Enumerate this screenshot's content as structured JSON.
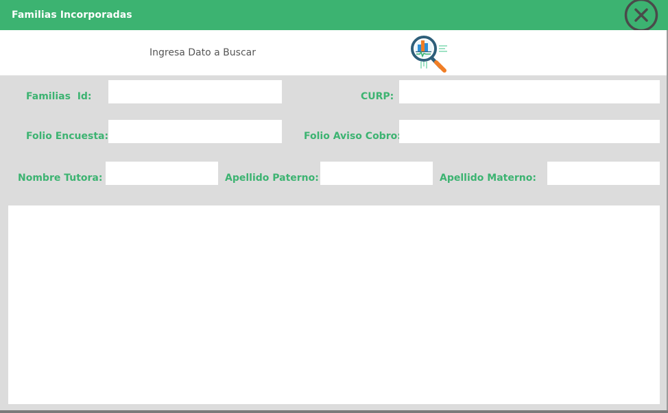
{
  "window": {
    "title": "Familias Incorporadas",
    "accent_color": "#3cb371"
  },
  "toolbar": {
    "close_icon": "close-circle-icon",
    "search_label": "Ingresa Dato a Buscar",
    "search_icon": "magnifier-chart-icon"
  },
  "form": {
    "familias_id": {
      "label": "Familias  Id:",
      "value": ""
    },
    "curp": {
      "label": "CURP:",
      "value": ""
    },
    "folio_encuesta": {
      "label": "Folio Encuesta:",
      "value": ""
    },
    "folio_aviso_cobro": {
      "label": "Folio Aviso Cobro:",
      "value": ""
    },
    "nombre_tutora": {
      "label": "Nombre Tutora:",
      "value": ""
    },
    "apellido_paterno": {
      "label": "Apellido Paterno:",
      "value": ""
    },
    "apellido_materno": {
      "label": "Apellido Materno:",
      "value": ""
    }
  },
  "results": {
    "rows": []
  }
}
